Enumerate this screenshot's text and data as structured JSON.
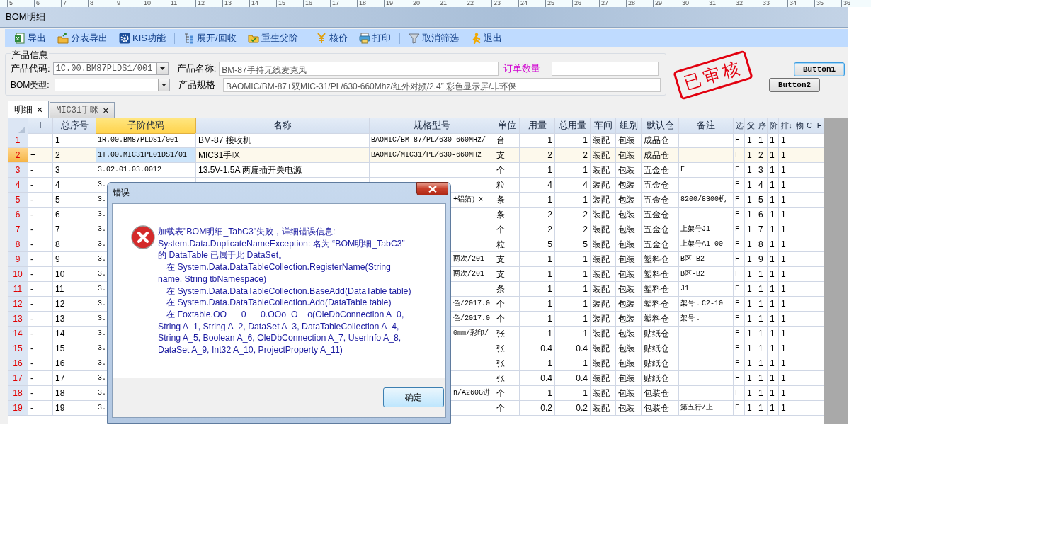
{
  "ruler": [
    "5",
    "6",
    "7",
    "8",
    "9",
    "10",
    "11",
    "12",
    "13",
    "14",
    "15",
    "16",
    "17",
    "18",
    "19",
    "20",
    "21",
    "22",
    "23",
    "24",
    "25",
    "26",
    "27",
    "28",
    "29",
    "30",
    "31",
    "32",
    "33",
    "34",
    "35",
    "36"
  ],
  "window": {
    "title": "BOM明细"
  },
  "toolbar_groups": [
    {
      "items": [
        "导出",
        "分表导出",
        "KIS功能"
      ]
    },
    {
      "items": [
        "展开/回收",
        "重生父阶"
      ]
    },
    {
      "items": [
        "核价",
        "打印"
      ]
    },
    {
      "items": [
        "取消筛选",
        "退出"
      ]
    }
  ],
  "product_info": {
    "legend": "产品信息",
    "code_label": "产品代码:",
    "code_value": "1C.00.BM87PLDS1/001",
    "name_label": "产品名称:",
    "name_value": "BM-87手持无线麦克风",
    "order_qty_label": "订单数量",
    "bom_type_label": "BOM类型:",
    "spec_label": "产品规格",
    "spec_value": "BAOMIC/BM-87+双MIC-31/PL/630-660Mhz/红外对频/2.4” 彩色显示屏/非环保"
  },
  "stamp": "已审核",
  "buttons": [
    "Button1",
    "Button2"
  ],
  "tabs": [
    {
      "label": "明细",
      "close": "×",
      "selected": true
    },
    {
      "label": "MIC31手咪",
      "close": "×",
      "selected": false
    }
  ],
  "grid": {
    "columns": [
      {
        "label": "i",
        "selected": false
      },
      {
        "label": "总序号",
        "selected": false
      },
      {
        "label": "子阶代码",
        "selected": true
      },
      {
        "label": "名称",
        "selected": false
      },
      {
        "label": "规格型号",
        "selected": false
      },
      {
        "label": "单位",
        "selected": false
      },
      {
        "label": "用量",
        "selected": false
      },
      {
        "label": "总用量",
        "selected": false
      },
      {
        "label": "车间",
        "selected": false
      },
      {
        "label": "组别",
        "selected": false
      },
      {
        "label": "默认仓",
        "selected": false
      },
      {
        "label": "备注",
        "selected": false
      },
      {
        "label": "选",
        "selected": false
      },
      {
        "label": "父",
        "selected": false
      },
      {
        "label": "序",
        "selected": false
      },
      {
        "label": "阶",
        "selected": false
      },
      {
        "label": "排↓",
        "selected": false
      },
      {
        "label": "物",
        "selected": false
      },
      {
        "label": "C",
        "selected": false
      },
      {
        "label": "F",
        "selected": false
      }
    ],
    "rows": [
      {
        "number": "1",
        "selected": false,
        "mark": "+",
        "seq": "1",
        "code": "1R.00.BM87PLDS1/001",
        "name": "BM-87 接收机",
        "spec": "BAOMIC/BM-87/PL/630-660MHz/",
        "unit": "台",
        "qty": "1",
        "total": "1",
        "workshop": "装配",
        "group": "包装",
        "warehouse": "成品仓",
        "pick": "F",
        "parent": "1",
        "order": "1",
        "level": "1",
        "sort": "1"
      },
      {
        "number": "2",
        "selected": true,
        "mark": "+",
        "seq": "2",
        "code": "1T.00.MIC31PL01DS1/01",
        "name": "MIC31手咪",
        "spec": "BAOMIC/MIC31/PL/630-660MHz",
        "unit": "支",
        "qty": "2",
        "total": "2",
        "workshop": "装配",
        "group": "包装",
        "warehouse": "成品仓",
        "pick": "F",
        "parent": "1",
        "order": "2",
        "level": "1",
        "sort": "1"
      },
      {
        "number": "3",
        "selected": false,
        "mark": "-",
        "seq": "3",
        "code": "3.02.01.03.0012",
        "name": "13.5V-1.5A 两扁插开关电源",
        "unit": "个",
        "qty": "1",
        "total": "1",
        "workshop": "装配",
        "group": "包装",
        "warehouse": "五金仓",
        "note": "F",
        "pick": "F",
        "parent": "1",
        "order": "3",
        "level": "1",
        "sort": "1"
      },
      {
        "number": "4",
        "selected": false,
        "mark": "-",
        "seq": "4",
        "code": "3.",
        "unit": "粒",
        "qty": "4",
        "total": "4",
        "workshop": "装配",
        "group": "包装",
        "warehouse": "五金仓",
        "pick": "F",
        "parent": "1",
        "order": "4",
        "level": "1",
        "sort": "1"
      },
      {
        "number": "5",
        "selected": false,
        "mark": "-",
        "seq": "5",
        "code": "3.",
        "spec": "+铝箔）x",
        "unit": "条",
        "qty": "1",
        "total": "1",
        "workshop": "装配",
        "group": "包装",
        "warehouse": "五金仓",
        "note": "8200/8300机",
        "pick": "F",
        "parent": "1",
        "order": "5",
        "level": "1",
        "sort": "1"
      },
      {
        "number": "6",
        "selected": false,
        "mark": "-",
        "seq": "6",
        "code": "3.",
        "unit": "条",
        "qty": "2",
        "total": "2",
        "workshop": "装配",
        "group": "包装",
        "warehouse": "五金仓",
        "pick": "F",
        "parent": "1",
        "order": "6",
        "level": "1",
        "sort": "1"
      },
      {
        "number": "7",
        "selected": false,
        "mark": "-",
        "seq": "7",
        "code": "3.",
        "unit": "个",
        "qty": "2",
        "total": "2",
        "workshop": "装配",
        "group": "包装",
        "warehouse": "五金仓",
        "note": "上架号J1",
        "pick": "F",
        "parent": "1",
        "order": "7",
        "level": "1",
        "sort": "1"
      },
      {
        "number": "8",
        "selected": false,
        "mark": "-",
        "seq": "8",
        "code": "3.",
        "unit": "粒",
        "qty": "5",
        "total": "5",
        "workshop": "装配",
        "group": "包装",
        "warehouse": "五金仓",
        "note": "上架号A1-00",
        "pick": "F",
        "parent": "1",
        "order": "8",
        "level": "1",
        "sort": "1"
      },
      {
        "number": "9",
        "selected": false,
        "mark": "-",
        "seq": "9",
        "code": "3.",
        "spec": "两次/201",
        "unit": "支",
        "qty": "1",
        "total": "1",
        "workshop": "装配",
        "group": "包装",
        "warehouse": "塑料仓",
        "note": "B区-B2",
        "pick": "F",
        "parent": "1",
        "order": "9",
        "level": "1",
        "sort": "1"
      },
      {
        "number": "10",
        "selected": false,
        "mark": "-",
        "seq": "10",
        "code": "3.",
        "spec": "两次/201",
        "unit": "支",
        "qty": "1",
        "total": "1",
        "workshop": "装配",
        "group": "包装",
        "warehouse": "塑料仓",
        "note": "B区-B2",
        "pick": "F",
        "parent": "1",
        "order": "1",
        "level": "1",
        "sort": "1"
      },
      {
        "number": "11",
        "selected": false,
        "mark": "-",
        "seq": "11",
        "code": "3.",
        "unit": "条",
        "qty": "1",
        "total": "1",
        "workshop": "装配",
        "group": "包装",
        "warehouse": "塑料仓",
        "note": "J1",
        "pick": "F",
        "parent": "1",
        "order": "1",
        "level": "1",
        "sort": "1"
      },
      {
        "number": "12",
        "selected": false,
        "mark": "-",
        "seq": "12",
        "code": "3.",
        "spec": "色/2017.0",
        "unit": "个",
        "qty": "1",
        "total": "1",
        "workshop": "装配",
        "group": "包装",
        "warehouse": "塑料仓",
        "note": "架号：C2-10",
        "pick": "F",
        "parent": "1",
        "order": "1",
        "level": "1",
        "sort": "1"
      },
      {
        "number": "13",
        "selected": false,
        "mark": "-",
        "seq": "13",
        "code": "3.",
        "spec": "色/2017.0",
        "unit": "个",
        "qty": "1",
        "total": "1",
        "workshop": "装配",
        "group": "包装",
        "warehouse": "塑料仓",
        "note": "架号：",
        "pick": "F",
        "parent": "1",
        "order": "1",
        "level": "1",
        "sort": "1"
      },
      {
        "number": "14",
        "selected": false,
        "mark": "-",
        "seq": "14",
        "code": "3.",
        "spec": "0mm/彩印/",
        "unit": "张",
        "qty": "1",
        "total": "1",
        "workshop": "装配",
        "group": "包装",
        "warehouse": "贴纸仓",
        "pick": "F",
        "parent": "1",
        "order": "1",
        "level": "1",
        "sort": "1"
      },
      {
        "number": "15",
        "selected": false,
        "mark": "-",
        "seq": "15",
        "code": "3.",
        "unit": "张",
        "qty": "0.4",
        "total": "0.4",
        "workshop": "装配",
        "group": "包装",
        "warehouse": "贴纸仓",
        "pick": "F",
        "parent": "1",
        "order": "1",
        "level": "1",
        "sort": "1"
      },
      {
        "number": "16",
        "selected": false,
        "mark": "-",
        "seq": "16",
        "code": "3.",
        "unit": "张",
        "qty": "1",
        "total": "1",
        "workshop": "装配",
        "group": "包装",
        "warehouse": "贴纸仓",
        "pick": "F",
        "parent": "1",
        "order": "1",
        "level": "1",
        "sort": "1"
      },
      {
        "number": "17",
        "selected": false,
        "mark": "-",
        "seq": "17",
        "code": "3.",
        "unit": "张",
        "qty": "0.4",
        "total": "0.4",
        "workshop": "装配",
        "group": "包装",
        "warehouse": "贴纸仓",
        "pick": "F",
        "parent": "1",
        "order": "1",
        "level": "1",
        "sort": "1"
      },
      {
        "number": "18",
        "selected": false,
        "mark": "-",
        "seq": "18",
        "code": "3.",
        "spec": "n/A260G进",
        "unit": "个",
        "qty": "1",
        "total": "1",
        "workshop": "装配",
        "group": "包装",
        "warehouse": "包装仓",
        "pick": "F",
        "parent": "1",
        "order": "1",
        "level": "1",
        "sort": "1"
      },
      {
        "number": "19",
        "selected": false,
        "mark": "-",
        "seq": "19",
        "code": "3.",
        "unit": "个",
        "qty": "0.2",
        "total": "0.2",
        "workshop": "装配",
        "group": "包装",
        "warehouse": "包装仓",
        "note": "第五行/上",
        "pick": "F",
        "parent": "1",
        "order": "1",
        "level": "1",
        "sort": "1"
      }
    ]
  },
  "dialog": {
    "title": "错误",
    "message_lines": [
      {
        "text": "加载表\"BOM明细_TabC3\"失败，详细错误信息:",
        "indent": false
      },
      {
        "text": "System.Data.DuplicateNameException: 名为 “BOM明细_TabC3”",
        "indent": false
      },
      {
        "text": "的 DataTable 已属于此 DataSet。",
        "indent": false
      },
      {
        "text": "在 System.Data.DataTableCollection.RegisterName(String",
        "indent": true
      },
      {
        "text": "name, String tbNamespace)",
        "indent": false
      },
      {
        "text": "在 System.Data.DataTableCollection.BaseAdd(DataTable table)",
        "indent": true
      },
      {
        "text": "在 System.Data.DataTableCollection.Add(DataTable table)",
        "indent": true
      },
      {
        "text": "在 Foxtable.OO      0      0.OOo_O__o(OleDbConnection A_0,",
        "indent": true
      },
      {
        "text": "String A_1, String A_2, DataSet A_3, DataTableCollection A_4,",
        "indent": false
      },
      {
        "text": "String A_5, Boolean A_6, OleDbConnection A_7, UserInfo A_8,",
        "indent": false
      },
      {
        "text": "DataSet A_9, Int32 A_10, ProjectProperty A_11)",
        "indent": false
      }
    ],
    "ok": "确定"
  }
}
